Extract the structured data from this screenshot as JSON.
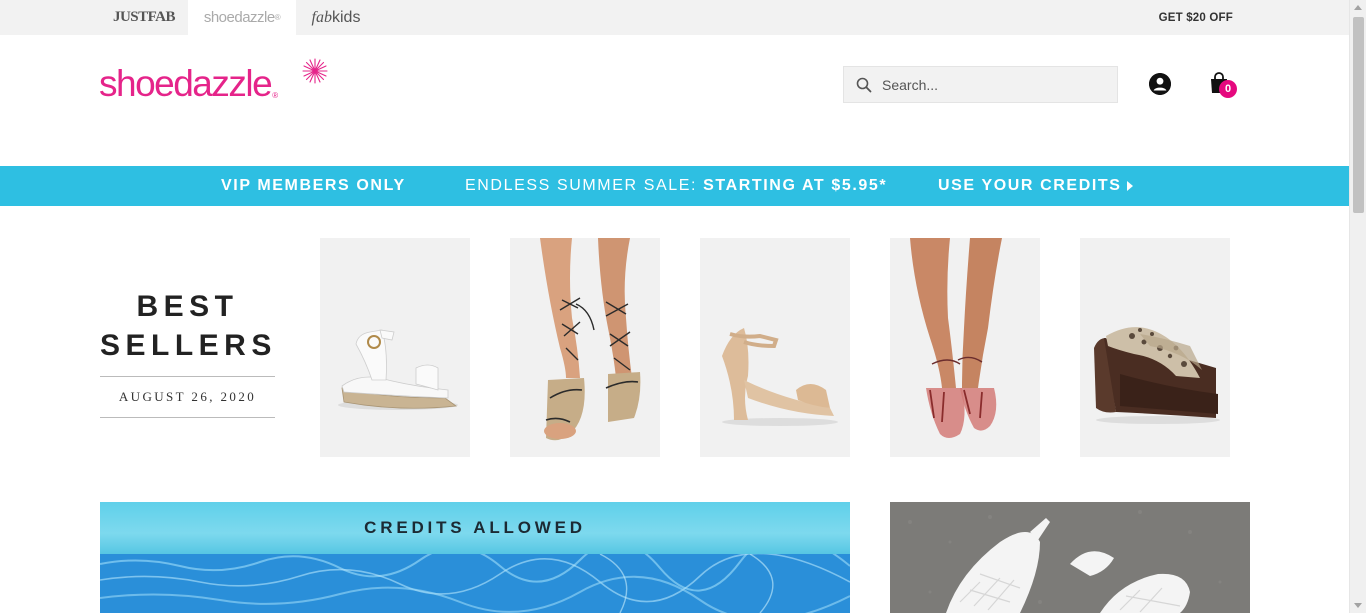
{
  "brand_strip": {
    "tabs": [
      {
        "name": "JUSTFAB"
      },
      {
        "name": "shoedazzle",
        "mark": "®"
      },
      {
        "name_italic": "fab",
        "name_rest": "kids"
      }
    ],
    "promo": "GET $20 OFF"
  },
  "header": {
    "logo_text": "shoedazzle",
    "logo_reg": "®",
    "search_placeholder": "Search...",
    "cart_count": "0",
    "colors": {
      "brand": "#e5248a",
      "badge": "#e5087e"
    }
  },
  "vip_banner": {
    "members": "VIP MEMBERS ONLY",
    "sale_prefix": "ENDLESS SUMMER SALE:",
    "sale_price": "STARTING AT $5.95*",
    "credits_link": "USE YOUR CREDITS",
    "color": "#2ebfe2"
  },
  "best_sellers": {
    "title_line1": "BEST",
    "title_line2": "SELLERS",
    "date": "AUGUST 26, 2020",
    "products": [
      {
        "icon": "white-espadrille-sandal-image"
      },
      {
        "icon": "lace-up-espadrille-wedge-image"
      },
      {
        "icon": "nude-sculpted-wedge-image"
      },
      {
        "icon": "red-clear-heeled-sandal-image"
      },
      {
        "icon": "snakeskin-platform-sandal-image"
      }
    ]
  },
  "promos": {
    "credits_label": "CREDITS ALLOWED"
  }
}
